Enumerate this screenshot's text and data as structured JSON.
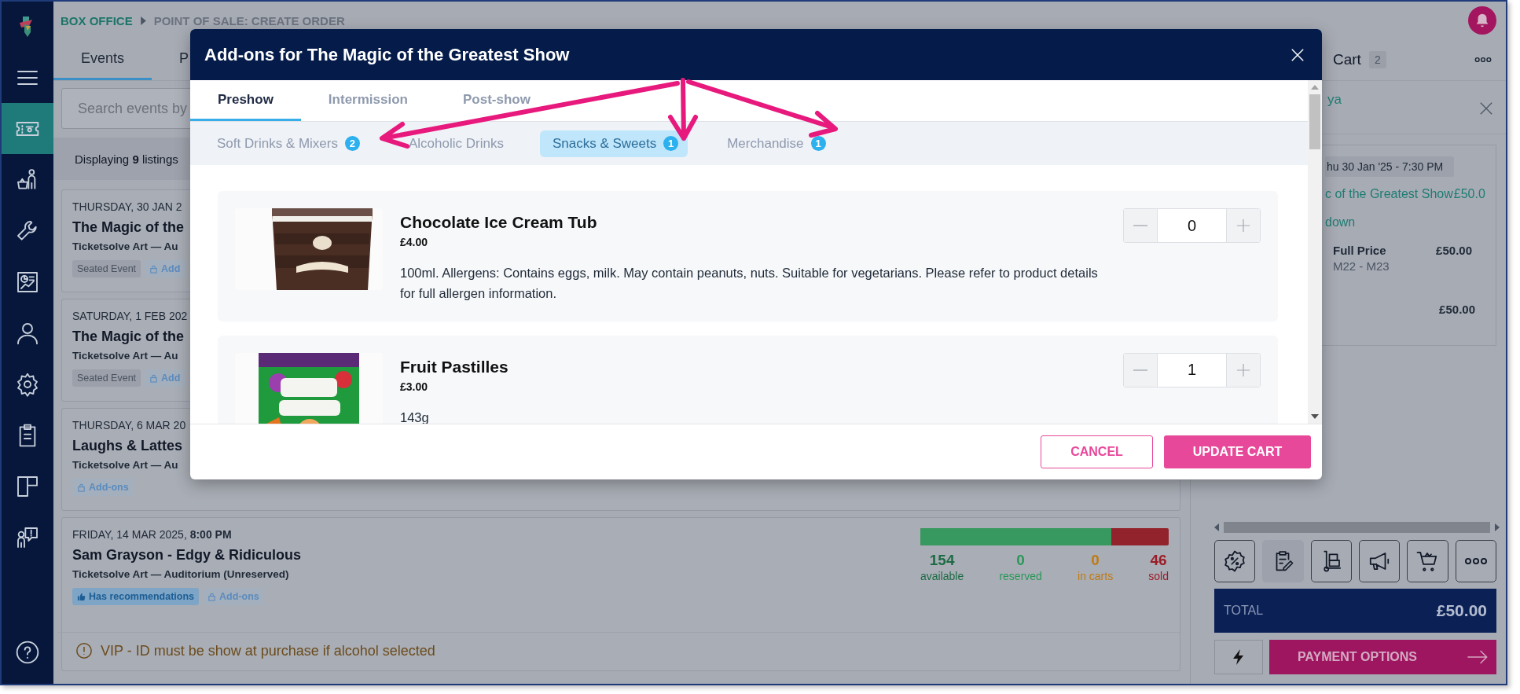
{
  "sidebar": {
    "items": [
      {
        "kind": "menu",
        "selected": false
      },
      {
        "kind": "ticket",
        "selected": true
      },
      {
        "kind": "basket-person",
        "selected": false
      },
      {
        "kind": "wrench",
        "selected": false
      },
      {
        "kind": "report",
        "selected": false
      },
      {
        "kind": "person",
        "selected": false
      },
      {
        "kind": "gear",
        "selected": false
      },
      {
        "kind": "clipboard",
        "selected": false
      },
      {
        "kind": "layout",
        "selected": false
      },
      {
        "kind": "feedback",
        "selected": false
      },
      {
        "kind": "help",
        "selected": false
      }
    ]
  },
  "breadcrumb": [
    "BOX OFFICE",
    "POINT OF SALE: CREATE ORDER"
  ],
  "tabs": [
    {
      "label": "Events",
      "selected": true
    },
    {
      "label": "P",
      "selected": false
    }
  ],
  "search": {
    "placeholder": "Search events by"
  },
  "listing_count": "Displaying **9** listings",
  "events": [
    {
      "date": "THURSDAY, 30 JAN 2",
      "title": "The Magic of the",
      "venue": "Ticketsolve Art — Au",
      "tags": [
        {
          "kind": "plain",
          "label": "Seated Event"
        },
        {
          "kind": "addons",
          "label": "Add"
        }
      ]
    },
    {
      "date": "SATURDAY, 1 FEB 202",
      "title": "The Magic of the",
      "venue": "Ticketsolve Art — Au",
      "tags": [
        {
          "kind": "plain",
          "label": "Seated Event"
        },
        {
          "kind": "addons",
          "label": "Add"
        }
      ]
    },
    {
      "date": "THURSDAY, 6 MAR 20",
      "title": "Laughs & Lattes",
      "venue": "Ticketsolve Art — Au",
      "tags": [
        {
          "kind": "addons",
          "label": "Add-ons"
        }
      ]
    },
    {
      "date": "FRIDAY, 14 MAR 2025, **8:00 PM**",
      "title": "Sam Grayson - Edgy & Ridiculous",
      "venue": "Ticketsolve Art — Auditorium (Unreserved)",
      "tags": [
        {
          "kind": "recommend",
          "label": "Has recommendations"
        },
        {
          "kind": "addons",
          "label": "Add-ons"
        }
      ],
      "stats": {
        "level": 0.77,
        "items": [
          {
            "value": "154",
            "label": "available",
            "color": "#1d6b45"
          },
          {
            "value": "0",
            "label": "reserved",
            "color": "#2a9858"
          },
          {
            "value": "0",
            "label": "in carts",
            "color": "#c07a12"
          },
          {
            "value": "46",
            "label": "sold",
            "color": "#9b1c26"
          }
        ]
      },
      "note": "VIP - ID must be show at purchase if alcohol selected"
    }
  ],
  "cart": {
    "title": "Cart",
    "count": "2",
    "customer": "ya",
    "chip": "hu 30 Jan '25 - 7:30 PM",
    "event_title": "c of the Greatest Show",
    "event_price": "£50.0",
    "link": "down",
    "lines": [
      {
        "name": "Full Price",
        "price": "£50.00",
        "seats": "M22 - M23"
      }
    ],
    "subtotal": "£50.00",
    "tools": [
      {
        "kind": "percent",
        "selected": false
      },
      {
        "kind": "clipboard-edit",
        "selected": true
      },
      {
        "kind": "dolly",
        "selected": false
      },
      {
        "kind": "megaphone",
        "selected": false
      },
      {
        "kind": "cart",
        "selected": false
      },
      {
        "kind": "more",
        "selected": false
      }
    ],
    "total_label": "TOTAL",
    "total": "£50.00",
    "pay": "PAYMENT OPTIONS"
  },
  "modal": {
    "title": "Add-ons for The Magic of the Greatest Show",
    "tabs": [
      {
        "label": "Preshow",
        "selected": true
      },
      {
        "label": "Intermission",
        "selected": false
      },
      {
        "label": "Post-show",
        "selected": false
      }
    ],
    "categories": [
      {
        "label": "Soft Drinks & Mixers",
        "count": "2",
        "selected": false
      },
      {
        "label": "Alcoholic Drinks",
        "selected": false
      },
      {
        "label": "Snacks & Sweets",
        "count": "1",
        "selected": true
      },
      {
        "label": "Merchandise",
        "count": "1",
        "selected": false
      }
    ],
    "products": [
      {
        "kind": "tub",
        "name": "Chocolate Ice Cream Tub",
        "price": "£4.00",
        "description": "100ml. Allergens: Contains eggs, milk. May contain peanuts, nuts. Suitable for vegetarians. Please refer to product details for full allergen information.",
        "quantity": "0"
      },
      {
        "kind": "bag",
        "name": "Fruit Pastilles",
        "price": "£3.00",
        "description": "143g",
        "quantity": "1"
      }
    ],
    "buttons": [
      {
        "kind": "secondary",
        "label": "CANCEL"
      },
      {
        "kind": "primary",
        "label": "UPDATE CART"
      }
    ]
  }
}
